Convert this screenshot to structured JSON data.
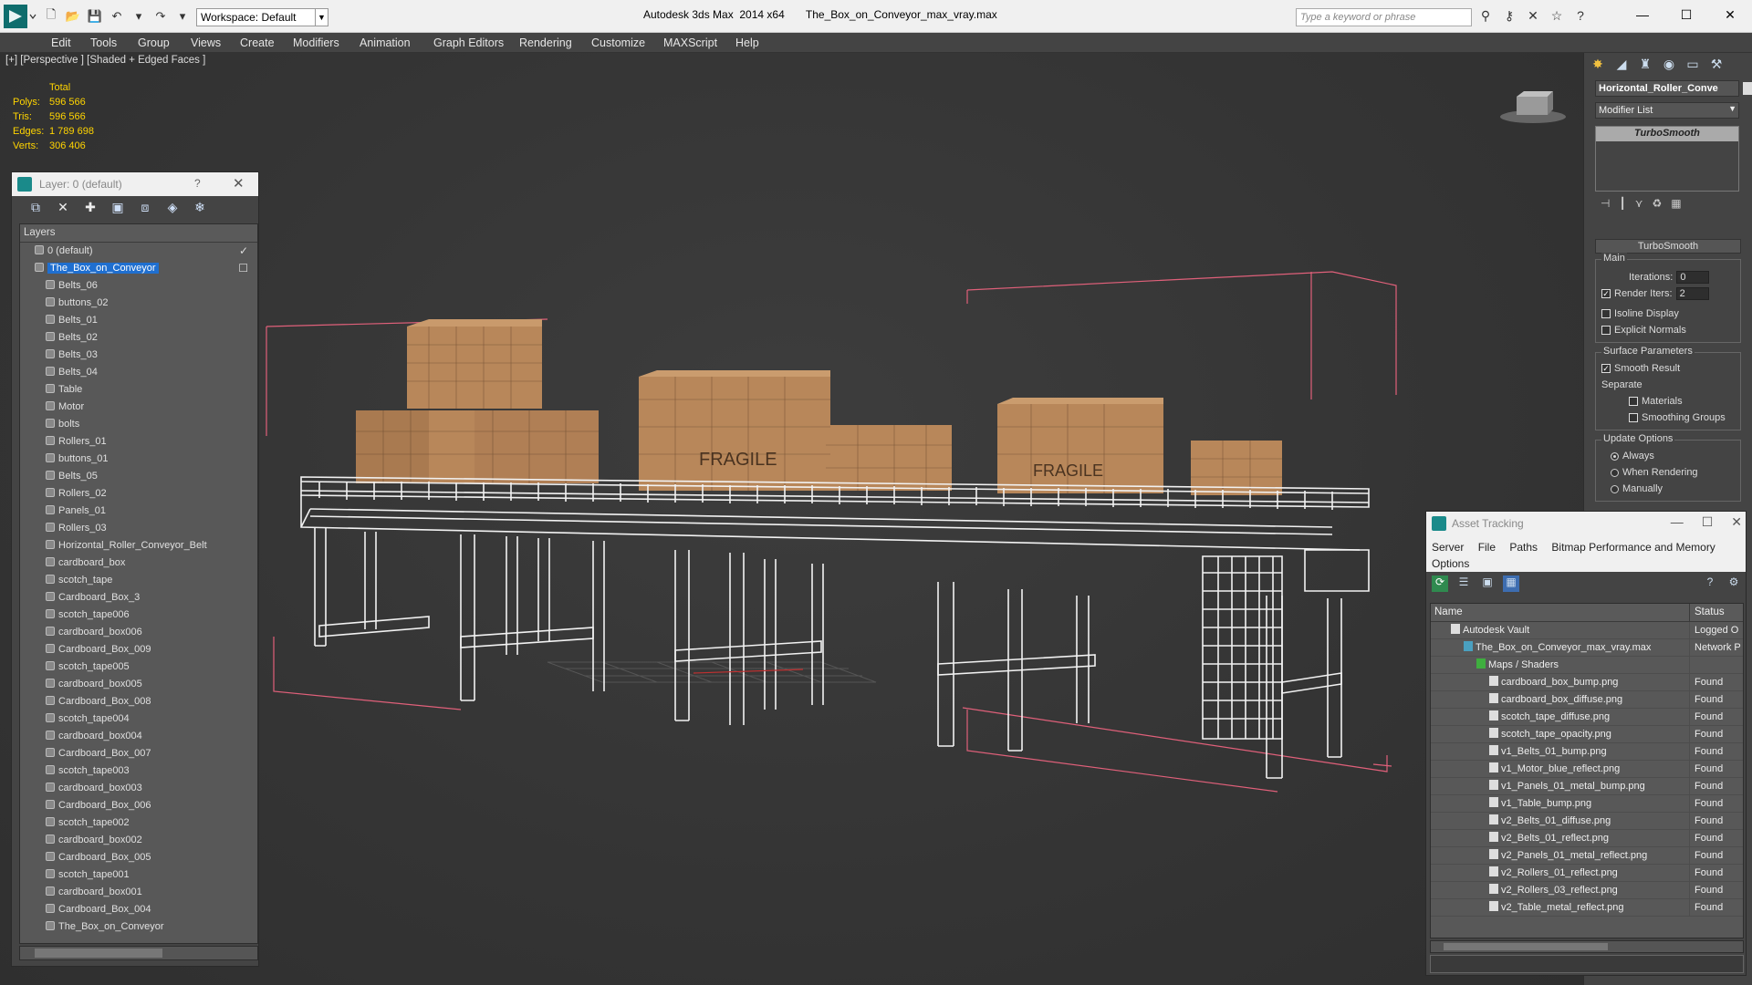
{
  "titlebar": {
    "workspace_value": "Workspace: Default",
    "app_title": "Autodesk 3ds Max  2014 x64       The_Box_on_Conveyor_max_vray.max",
    "search_placeholder": "Type a keyword or phrase"
  },
  "menubar": {
    "items": [
      "Edit",
      "Tools",
      "Group",
      "Views",
      "Create",
      "Modifiers",
      "Animation",
      "Graph Editors",
      "Rendering",
      "Customize",
      "MAXScript",
      "Help"
    ]
  },
  "viewport": {
    "label": "[+] [Perspective ] [Shaded + Edged Faces ]",
    "stats": {
      "header": "Total",
      "rows": [
        {
          "k": "Polys:",
          "v": "596 566"
        },
        {
          "k": "Tris:",
          "v": "596 566"
        },
        {
          "k": "Edges:",
          "v": "1 789 698"
        },
        {
          "k": "Verts:",
          "v": "306 406"
        }
      ]
    },
    "box_label": "FRAGILE"
  },
  "layer_panel": {
    "title": "Layer: 0 (default)",
    "help": "?",
    "header": "Layers",
    "layers": [
      {
        "name": "0 (default)",
        "level": 1,
        "selected": false,
        "checked": true
      },
      {
        "name": "The_Box_on_Conveyor",
        "level": 1,
        "selected": true,
        "checked": false
      },
      {
        "name": "Belts_06",
        "level": 2
      },
      {
        "name": "buttons_02",
        "level": 2
      },
      {
        "name": "Belts_01",
        "level": 2
      },
      {
        "name": "Belts_02",
        "level": 2
      },
      {
        "name": "Belts_03",
        "level": 2
      },
      {
        "name": "Belts_04",
        "level": 2
      },
      {
        "name": "Table",
        "level": 2
      },
      {
        "name": "Motor",
        "level": 2
      },
      {
        "name": "bolts",
        "level": 2
      },
      {
        "name": "Rollers_01",
        "level": 2
      },
      {
        "name": "buttons_01",
        "level": 2
      },
      {
        "name": "Belts_05",
        "level": 2
      },
      {
        "name": "Rollers_02",
        "level": 2
      },
      {
        "name": "Panels_01",
        "level": 2
      },
      {
        "name": "Rollers_03",
        "level": 2
      },
      {
        "name": "Horizontal_Roller_Conveyor_Belt",
        "level": 2
      },
      {
        "name": "cardboard_box",
        "level": 2
      },
      {
        "name": "scotch_tape",
        "level": 2
      },
      {
        "name": "Cardboard_Box_3",
        "level": 2
      },
      {
        "name": "scotch_tape006",
        "level": 2
      },
      {
        "name": "cardboard_box006",
        "level": 2
      },
      {
        "name": "Cardboard_Box_009",
        "level": 2
      },
      {
        "name": "scotch_tape005",
        "level": 2
      },
      {
        "name": "cardboard_box005",
        "level": 2
      },
      {
        "name": "Cardboard_Box_008",
        "level": 2
      },
      {
        "name": "scotch_tape004",
        "level": 2
      },
      {
        "name": "cardboard_box004",
        "level": 2
      },
      {
        "name": "Cardboard_Box_007",
        "level": 2
      },
      {
        "name": "scotch_tape003",
        "level": 2
      },
      {
        "name": "cardboard_box003",
        "level": 2
      },
      {
        "name": "Cardboard_Box_006",
        "level": 2
      },
      {
        "name": "scotch_tape002",
        "level": 2
      },
      {
        "name": "cardboard_box002",
        "level": 2
      },
      {
        "name": "Cardboard_Box_005",
        "level": 2
      },
      {
        "name": "scotch_tape001",
        "level": 2
      },
      {
        "name": "cardboard_box001",
        "level": 2
      },
      {
        "name": "Cardboard_Box_004",
        "level": 2
      },
      {
        "name": "The_Box_on_Conveyor",
        "level": 2
      }
    ]
  },
  "command_panel": {
    "object_name": "Horizontal_Roller_Conve",
    "modifier_list": "Modifier List",
    "stack_item": "TurboSmooth",
    "rollout_title": "TurboSmooth",
    "main_group": "Main",
    "iterations_label": "Iterations:",
    "iterations_value": "0",
    "render_iters_label": "Render Iters:",
    "render_iters_value": "2",
    "isoline": "Isoline Display",
    "explicit_normals": "Explicit Normals",
    "surface_group": "Surface Parameters",
    "smooth_result": "Smooth Result",
    "separate": "Separate",
    "materials": "Materials",
    "smoothing_groups": "Smoothing Groups",
    "update_group": "Update Options",
    "always": "Always",
    "when_rendering": "When Rendering",
    "manually": "Manually"
  },
  "asset_panel": {
    "title": "Asset Tracking",
    "menu_row1": [
      "Server",
      "File",
      "Paths",
      "Bitmap Performance and Memory"
    ],
    "menu_row2": [
      "Options"
    ],
    "col_name": "Name",
    "col_status": "Status",
    "rows": [
      {
        "name": "Autodesk Vault",
        "status": "Logged O",
        "indent": 1
      },
      {
        "name": "The_Box_on_Conveyor_max_vray.max",
        "status": "Network P",
        "indent": 2
      },
      {
        "name": "Maps / Shaders",
        "status": "",
        "indent": 3
      },
      {
        "name": "cardboard_box_bump.png",
        "status": "Found",
        "indent": 4
      },
      {
        "name": "cardboard_box_diffuse.png",
        "status": "Found",
        "indent": 4
      },
      {
        "name": "scotch_tape_diffuse.png",
        "status": "Found",
        "indent": 4
      },
      {
        "name": "scotch_tape_opacity.png",
        "status": "Found",
        "indent": 4
      },
      {
        "name": "v1_Belts_01_bump.png",
        "status": "Found",
        "indent": 4
      },
      {
        "name": "v1_Motor_blue_reflect.png",
        "status": "Found",
        "indent": 4
      },
      {
        "name": "v1_Panels_01_metal_bump.png",
        "status": "Found",
        "indent": 4
      },
      {
        "name": "v1_Table_bump.png",
        "status": "Found",
        "indent": 4
      },
      {
        "name": "v2_Belts_01_diffuse.png",
        "status": "Found",
        "indent": 4
      },
      {
        "name": "v2_Belts_01_reflect.png",
        "status": "Found",
        "indent": 4
      },
      {
        "name": "v2_Panels_01_metal_reflect.png",
        "status": "Found",
        "indent": 4
      },
      {
        "name": "v2_Rollers_01_reflect.png",
        "status": "Found",
        "indent": 4
      },
      {
        "name": "v2_Rollers_03_reflect.png",
        "status": "Found",
        "indent": 4
      },
      {
        "name": "v2_Table_metal_reflect.png",
        "status": "Found",
        "indent": 4
      }
    ]
  },
  "colors": {
    "selection_blue": "#1f6fd0",
    "stats_yellow": "#ffd400",
    "bbox_pink": "#e0607a",
    "cardboard": "#b8875a"
  }
}
